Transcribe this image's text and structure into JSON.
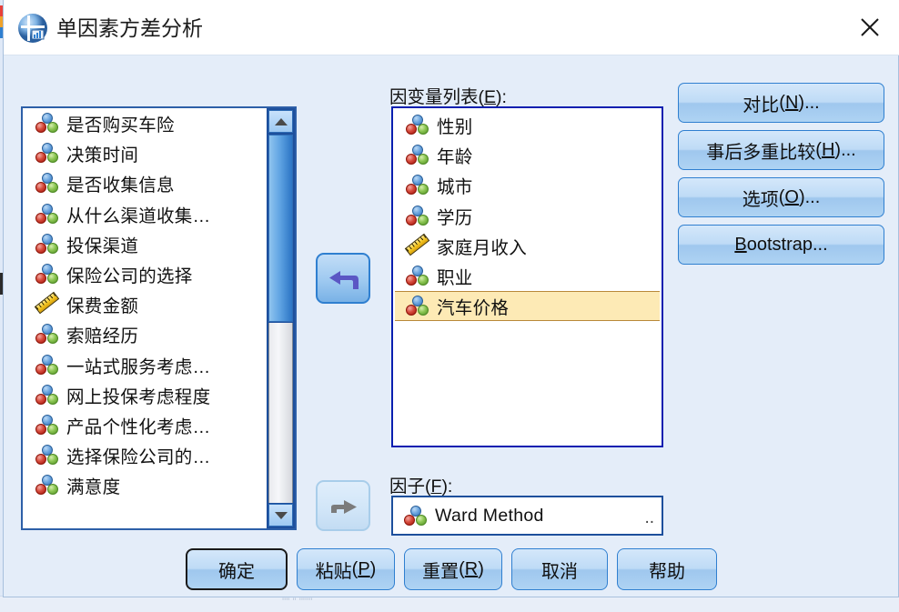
{
  "window": {
    "title": "单因素方差分析",
    "icon": "spss-anova-icon",
    "close_label": "×",
    "background_color": "#e4edf9",
    "titlebar_color": "#ffffff"
  },
  "source_list": {
    "name": "source-variable-list",
    "items": [
      {
        "label": "是否购买车险",
        "icon": "nominal-icon"
      },
      {
        "label": "决策时间",
        "icon": "nominal-icon"
      },
      {
        "label": "是否收集信息",
        "icon": "nominal-icon"
      },
      {
        "label": "从什么渠道收集…",
        "icon": "nominal-icon"
      },
      {
        "label": "投保渠道",
        "icon": "nominal-icon"
      },
      {
        "label": "保险公司的选择",
        "icon": "nominal-icon"
      },
      {
        "label": "保费金额",
        "icon": "scale-icon"
      },
      {
        "label": "索赔经历",
        "icon": "nominal-icon"
      },
      {
        "label": "一站式服务考虑…",
        "icon": "nominal-icon"
      },
      {
        "label": "网上投保考虑程度",
        "icon": "nominal-icon"
      },
      {
        "label": "产品个性化考虑…",
        "icon": "nominal-icon"
      },
      {
        "label": "选择保险公司的…",
        "icon": "nominal-icon"
      },
      {
        "label": "满意度",
        "icon": "nominal-icon"
      }
    ],
    "scrollbar": {
      "up_arrow": "scroll-up-icon",
      "down_arrow": "scroll-down-icon",
      "thumb_color": "#5ea2e2"
    }
  },
  "dependent": {
    "label": "因变量列表(E):",
    "label_text": "因变量列表",
    "accelerator": "E",
    "items": [
      {
        "label": "性别",
        "icon": "nominal-icon",
        "selected": false
      },
      {
        "label": "年龄",
        "icon": "nominal-icon",
        "selected": false
      },
      {
        "label": "城市",
        "icon": "nominal-icon",
        "selected": false
      },
      {
        "label": "学历",
        "icon": "nominal-icon",
        "selected": false
      },
      {
        "label": "家庭月收入",
        "icon": "scale-icon",
        "selected": false
      },
      {
        "label": "职业",
        "icon": "nominal-icon",
        "selected": false
      },
      {
        "label": "汽车价格",
        "icon": "nominal-icon",
        "selected": true
      }
    ],
    "selected_item": "汽车价格",
    "selection_fill": "#fdeab5",
    "selection_border": "#b9893a"
  },
  "factor": {
    "label": "因子(F):",
    "label_text": "因子",
    "accelerator": "F",
    "value": "Ward Method",
    "icon": "nominal-icon",
    "ellipsis": ".."
  },
  "arrows": {
    "to_dependent": {
      "name": "move-to-dependent-arrow",
      "direction": "left",
      "enabled": true
    },
    "to_factor": {
      "name": "move-to-factor-arrow",
      "direction": "right",
      "enabled": false
    }
  },
  "option_buttons": [
    {
      "name": "contrasts-button",
      "text": "对比(N)...",
      "label": "对比",
      "accelerator": "N",
      "suffix": "..."
    },
    {
      "name": "posthoc-button",
      "text": "事后多重比较(H)...",
      "label": "事后多重比较",
      "accelerator": "H",
      "suffix": "..."
    },
    {
      "name": "options-button",
      "text": "选项(O)...",
      "label": "选项",
      "accelerator": "O",
      "suffix": "..."
    },
    {
      "name": "bootstrap-button",
      "text": "Bootstrap...",
      "label": "ootstrap",
      "accelerator": "B",
      "suffix": "..."
    }
  ],
  "bottom_buttons": [
    {
      "name": "ok-button",
      "text": "确定",
      "label": "确定",
      "accelerator": "",
      "default": true
    },
    {
      "name": "paste-button",
      "text": "粘贴(P)",
      "label": "粘贴",
      "accelerator": "P",
      "default": false
    },
    {
      "name": "reset-button",
      "text": "重置(R)",
      "label": "重置",
      "accelerator": "R",
      "default": false
    },
    {
      "name": "cancel-button",
      "text": "取消",
      "label": "取消",
      "accelerator": "",
      "default": false
    },
    {
      "name": "help-button",
      "text": "帮助",
      "label": "帮助",
      "accelerator": "",
      "default": false
    }
  ],
  "background": {
    "bottom_text": "'''' '' '''''''",
    "stripe_colors": [
      "#e8413a",
      "#f0a32b",
      "#2f7fd0",
      "#3aa05a"
    ]
  }
}
